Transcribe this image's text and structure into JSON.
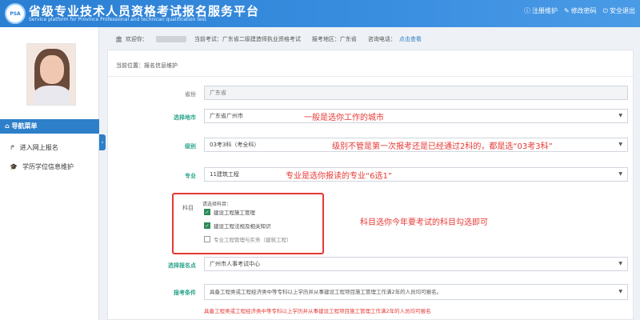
{
  "header": {
    "logo_text": "PSA",
    "title": "省级专业技术人员资格考试报名服务平台",
    "subtitle": "Service platform for Province Professional and technican qualification test",
    "links": [
      {
        "icon": "info-icon",
        "label": "注册维护"
      },
      {
        "icon": "edit-icon",
        "label": "修改密码"
      },
      {
        "icon": "power-icon",
        "label": "安全退出"
      }
    ]
  },
  "sidebar": {
    "nav_header": "导航菜单",
    "items": [
      {
        "icon": "share-icon",
        "label": "进入网上报名"
      },
      {
        "icon": "graduation-icon",
        "label": "学历学位信息维护"
      }
    ]
  },
  "infobar": {
    "welcome": "欢迎你：",
    "current_exam": "当前考试：广东省二级建造师执业资格考试",
    "region": "报考地区：广东省",
    "phone_label": "咨询电话：",
    "phone_link": "点击查看"
  },
  "breadcrumb": "当前位置：报名信息维护",
  "form": {
    "province": {
      "label": "省份",
      "value": "广东省"
    },
    "city": {
      "label": "选择地市",
      "value": "广东省广州市",
      "note": "一般是选你工作的城市"
    },
    "level": {
      "label": "级别",
      "value": "03考3科（考全科）",
      "note": "级别不管是第一次报考还是已经通过2科的，都是选“03考3科”"
    },
    "major": {
      "label": "专业",
      "value": "11建筑工程",
      "note": "专业是选你报读的专业“6选1”"
    },
    "subjects": {
      "label": "科目",
      "title": "请选择科目：",
      "note": "科目选你今年要考试的科目勾选即可",
      "items": [
        {
          "label": "建设工程施工管理",
          "checked": true
        },
        {
          "label": "建设工程法规及相关知识",
          "checked": true
        },
        {
          "label": "专业工程管理与实务（建筑工程）",
          "checked": false
        }
      ]
    },
    "site": {
      "label": "选择报名点",
      "value": "广州市人事考试中心"
    },
    "condition": {
      "label": "报考条件",
      "value": "具备工程类或工程经济类中等专科以上学历并从事建设工程项目施工管理工作满2年的人员均可报名。"
    },
    "warning": "具备工程类或工程经济类中等专科以上学历并从事建设工程项目施工管理工作满2年的人员均可报名"
  }
}
